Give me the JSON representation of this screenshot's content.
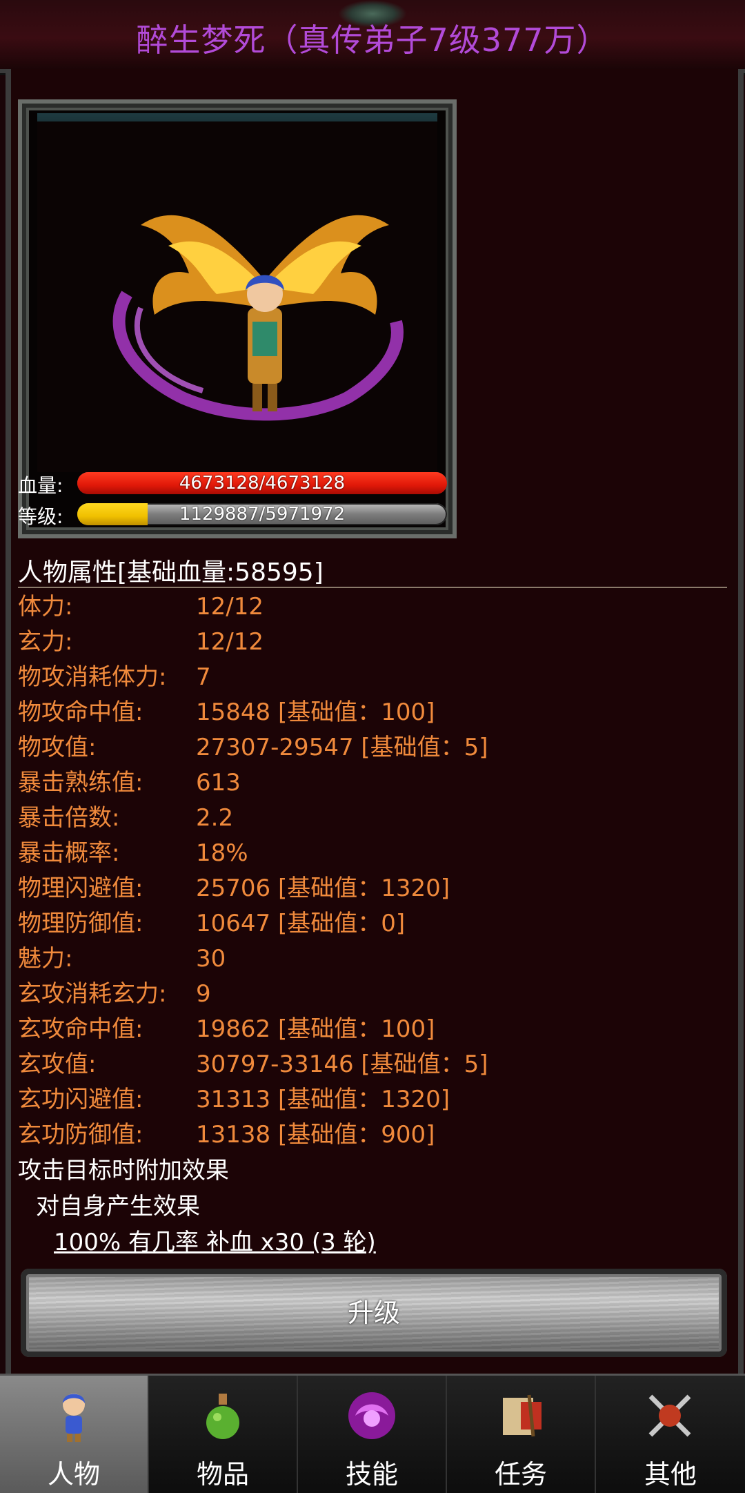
{
  "title": "醉生梦死（真传弟子7级377万）",
  "portrait": {
    "hp_label": "血量:",
    "hp_text": "4673128/4673128",
    "hp_percent": 100,
    "level_label": "等级:",
    "level_text": "1129887/5971972",
    "level_percent": 19
  },
  "attributes": {
    "section_title": "人物属性[基础血量:58595]",
    "rows": [
      {
        "label": "体力:",
        "value": "12/12"
      },
      {
        "label": "玄力:",
        "value": "12/12"
      },
      {
        "label": "物攻消耗体力:",
        "value": "7"
      },
      {
        "label": "物攻命中值:",
        "value": "15848 [基础值：100]"
      },
      {
        "label": "物攻值:",
        "value": "27307-29547 [基础值：5]"
      },
      {
        "label": "暴击熟练值:",
        "value": "613"
      },
      {
        "label": "暴击倍数:",
        "value": "2.2"
      },
      {
        "label": "暴击概率:",
        "value": "18%"
      },
      {
        "label": "物理闪避值:",
        "value": "25706 [基础值：1320]"
      },
      {
        "label": "物理防御值:",
        "value": "10647 [基础值：0]"
      },
      {
        "label": "魅力:",
        "value": "30"
      },
      {
        "label": "玄攻消耗玄力:",
        "value": "9"
      },
      {
        "label": "玄攻命中值:",
        "value": "19862 [基础值：100]"
      },
      {
        "label": "玄攻值:",
        "value": "30797-33146 [基础值：5]"
      },
      {
        "label": "玄功闪避值:",
        "value": "31313 [基础值：1320]"
      },
      {
        "label": "玄功防御值:",
        "value": "13138 [基础值：900]"
      }
    ]
  },
  "effects": {
    "header": "攻击目标时附加效果",
    "self_header": "对自身产生效果",
    "effect_text": "100% 有几率 补血 x30 (3 轮)"
  },
  "upgrade_label": "升级",
  "nav": [
    {
      "label": "人物",
      "icon": "character-icon",
      "active": true
    },
    {
      "label": "物品",
      "icon": "potion-icon",
      "active": false
    },
    {
      "label": "技能",
      "icon": "skill-orb-icon",
      "active": false
    },
    {
      "label": "任务",
      "icon": "quest-scroll-icon",
      "active": false
    },
    {
      "label": "其他",
      "icon": "crossed-swords-icon",
      "active": false
    }
  ],
  "colors": {
    "title": "#b24bd8",
    "attr_text": "#f08a3c",
    "hp_bar": "#e82010",
    "level_bar": "#f0c000"
  }
}
